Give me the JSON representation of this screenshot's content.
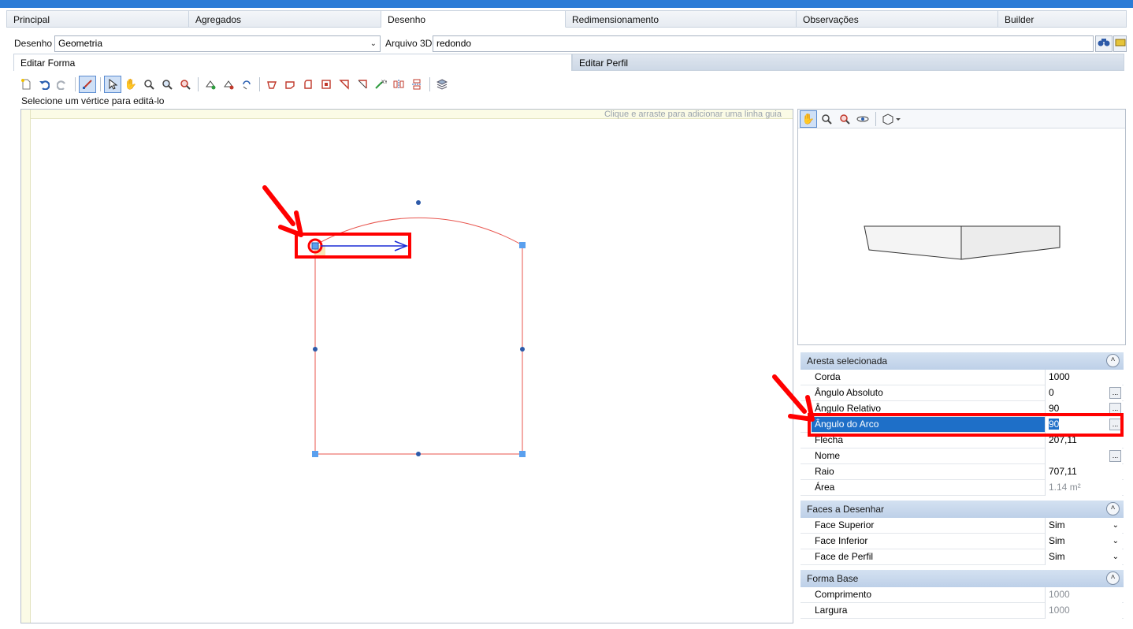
{
  "tabs": [
    {
      "label": "Principal",
      "active": false
    },
    {
      "label": "Agregados",
      "active": false
    },
    {
      "label": "Desenho",
      "active": true
    },
    {
      "label": "Redimensionamento",
      "active": false
    },
    {
      "label": "Observações",
      "active": false
    },
    {
      "label": "Builder",
      "active": false
    }
  ],
  "form": {
    "desenho_label": "Desenho",
    "desenho_value": "Geometria",
    "arquivo_label": "Arquivo 3D",
    "arquivo_value": "redondo"
  },
  "subtabs": [
    {
      "label": "Editar Forma",
      "active": true
    },
    {
      "label": "Editar Perfil",
      "active": false
    }
  ],
  "toolbar": {
    "tools": [
      "new-icon",
      "undo-icon",
      "redo-icon",
      "edit-vertex-icon",
      "select-icon",
      "pan-icon",
      "zoom-in-icon",
      "zoom-out-icon",
      "zoom-window-icon",
      "add-vertex-icon",
      "remove-vertex-icon",
      "rotate-icon",
      "shape-1-icon",
      "shape-2-icon",
      "shape-3-icon",
      "shape-4-icon",
      "shape-5-icon",
      "shape-6-icon",
      "mirror-icon",
      "flip-icon",
      "stack-icon",
      "layers-icon"
    ]
  },
  "hint_text": "Selecione um vértice para editá-lo",
  "canvas": {
    "guide_hint": "Clique e arraste para adicionar uma linha guia"
  },
  "panels": {
    "aresta": {
      "title": "Aresta selecionada",
      "rows": [
        {
          "name": "Corda",
          "value": "1000",
          "btn": false,
          "ro": false,
          "sel": false
        },
        {
          "name": "Ângulo Absoluto",
          "value": "0",
          "btn": true,
          "ro": false,
          "sel": false
        },
        {
          "name": "Ângulo Relativo",
          "value": "90",
          "btn": true,
          "ro": false,
          "sel": false
        },
        {
          "name": "Ângulo do Arco",
          "value": "90",
          "btn": true,
          "ro": false,
          "sel": true
        },
        {
          "name": "Flecha",
          "value": "207,11",
          "btn": false,
          "ro": false,
          "sel": false
        },
        {
          "name": "Nome",
          "value": "",
          "btn": true,
          "ro": false,
          "sel": false
        },
        {
          "name": "Raio",
          "value": "707,11",
          "btn": false,
          "ro": false,
          "sel": false
        },
        {
          "name": "Área",
          "value": "1.14 m²",
          "btn": false,
          "ro": true,
          "sel": false
        }
      ]
    },
    "faces": {
      "title": "Faces a Desenhar",
      "rows": [
        {
          "name": "Face Superior",
          "value": "Sim"
        },
        {
          "name": "Face Inferior",
          "value": "Sim"
        },
        {
          "name": "Face de Perfil",
          "value": "Sim"
        }
      ]
    },
    "forma": {
      "title": "Forma Base",
      "rows": [
        {
          "name": "Comprimento",
          "value": "1000"
        },
        {
          "name": "Largura",
          "value": "1000"
        }
      ]
    }
  },
  "colors": {
    "accent": "#2c7cd6",
    "selection": "#1e6fc8",
    "shape_line": "#e8554e",
    "annotation": "#ff0000",
    "direction_arrow": "#1a2bd6"
  }
}
